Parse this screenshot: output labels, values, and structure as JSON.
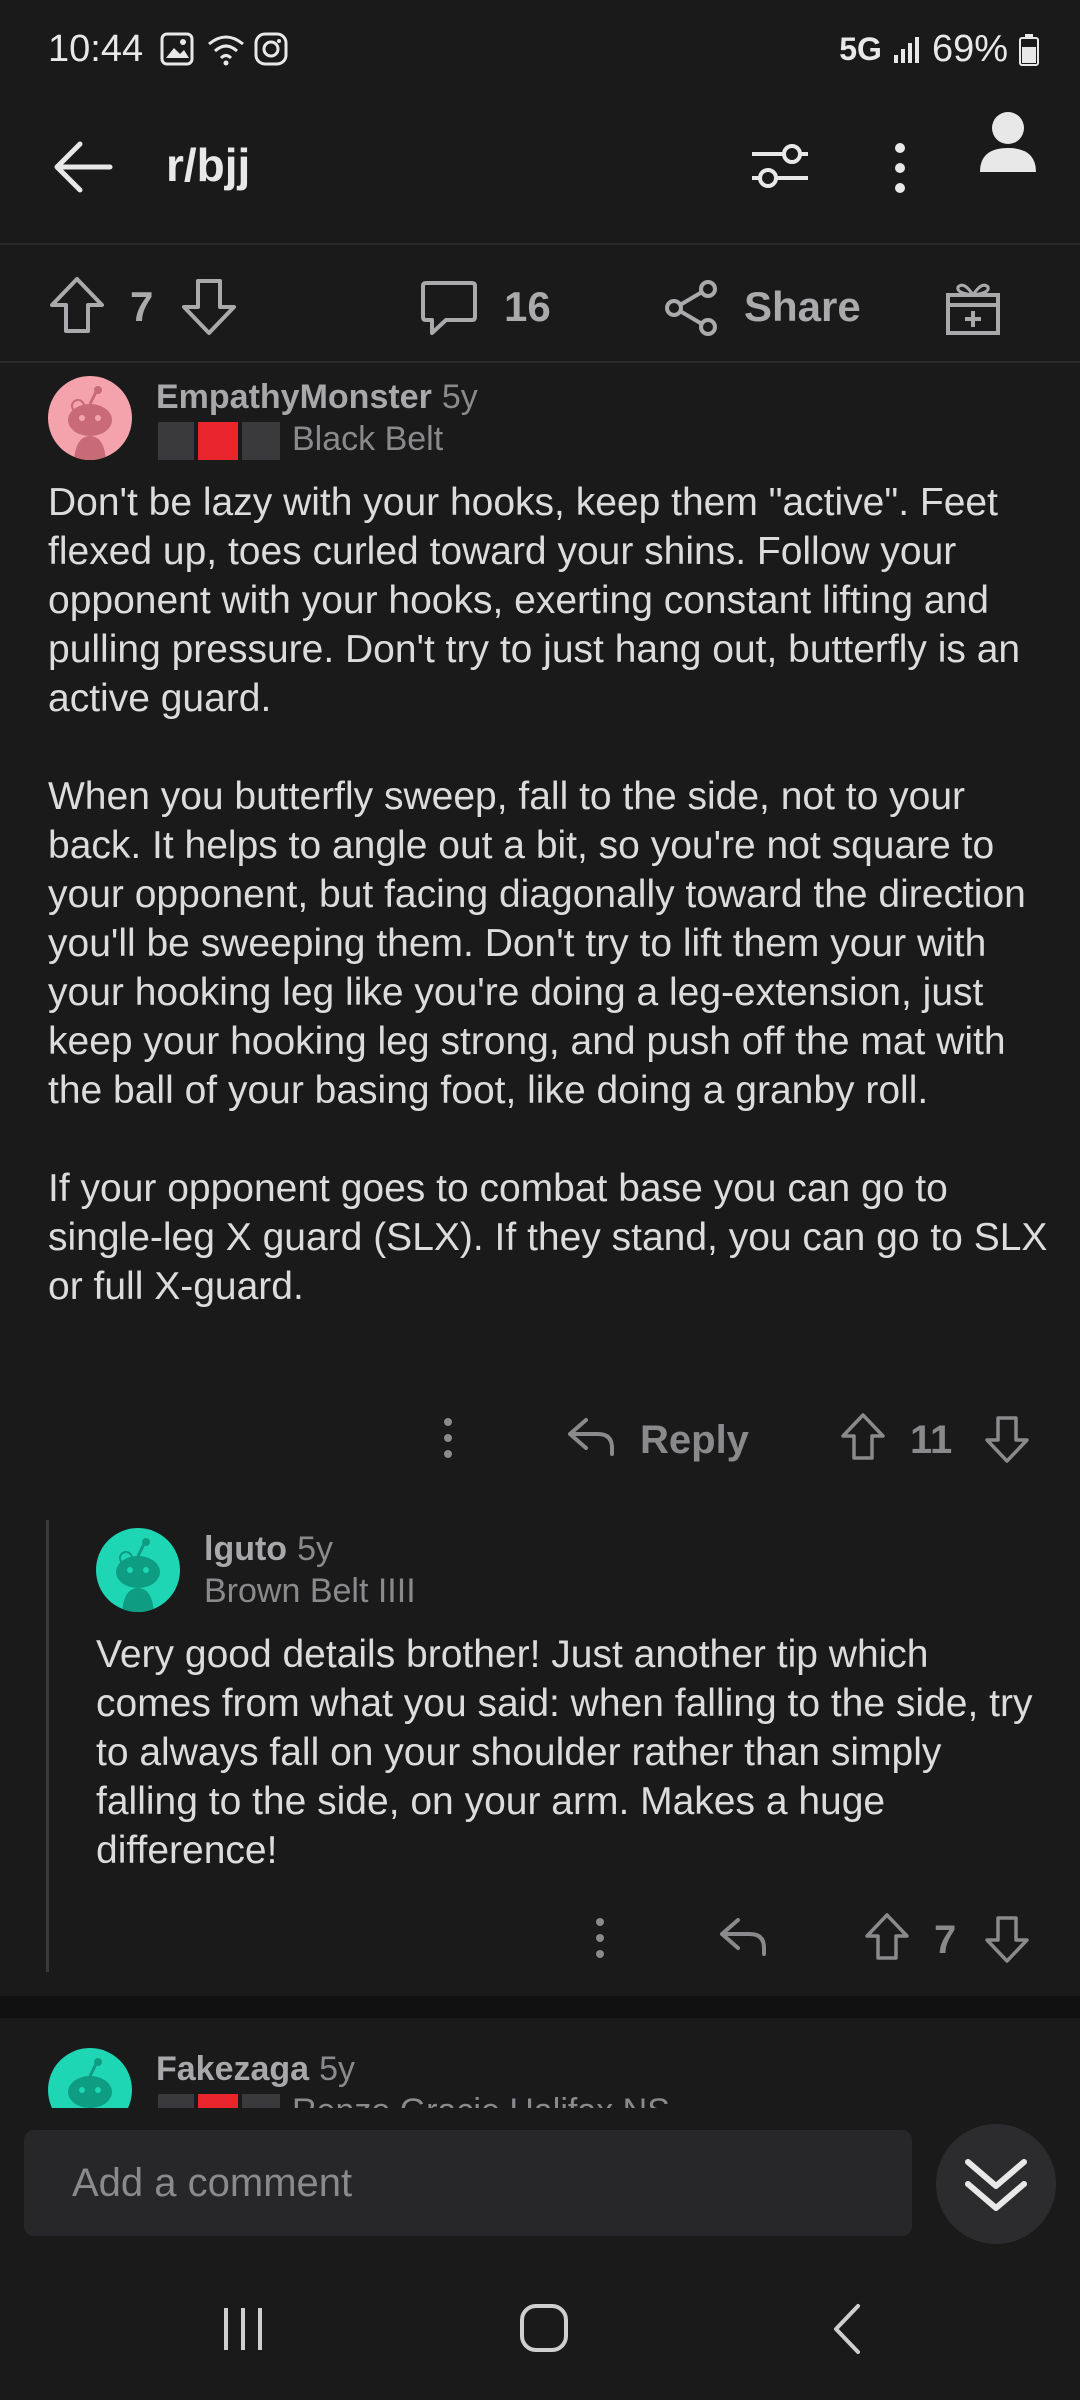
{
  "status_bar": {
    "time": "10:44",
    "network": "5G",
    "battery": "69%"
  },
  "header": {
    "title": "r/bjj"
  },
  "post_actions": {
    "upvotes": "7",
    "comments": "16",
    "share_label": "Share"
  },
  "comments": [
    {
      "username": "EmpathyMonster",
      "age": "5y",
      "flair": "Black Belt",
      "paragraphs": [
        "Don't be lazy with your hooks, keep them \"active\". Feet flexed up, toes curled toward your shins. Follow your opponent with your hooks, exerting constant lifting and pulling pressure. Don't try to just hang out, butterfly is an active guard.",
        "When you butterfly sweep, fall to the side, not to your back. It helps to angle out a bit, so you're not square to your opponent, but facing diagonally toward the direction you'll be sweeping them.  Don't try to lift them your with your hooking leg like you're doing a leg-extension, just keep your hooking leg strong, and push off the mat with the ball of your basing foot, like doing a granby roll.",
        "If your opponent goes to combat base you can go to single-leg X guard (SLX). If they stand, you can go to SLX or full X-guard."
      ],
      "reply_label": "Reply",
      "votes": "11"
    },
    {
      "username": "lguto",
      "age": "5y",
      "flair": "Brown Belt IIII",
      "paragraphs": [
        "Very good details brother! Just another tip which comes from what you said: when falling to the side, try to always fall on your shoulder rather than simply falling to the side, on your arm. Makes a huge difference!"
      ],
      "votes": "7"
    },
    {
      "username": "Fakezaga",
      "age": "5y",
      "flair": "Renzo Gracie Halifax NS"
    }
  ],
  "comment_bar": {
    "placeholder": "Add a comment"
  },
  "colors": {
    "background": "#1a1a1b",
    "text": "#dcdcdc",
    "muted": "#8a8a8d",
    "avatar_pink": "#f4a3ad",
    "avatar_teal": "#1fd6b4",
    "flair_red": "#e8242c"
  }
}
